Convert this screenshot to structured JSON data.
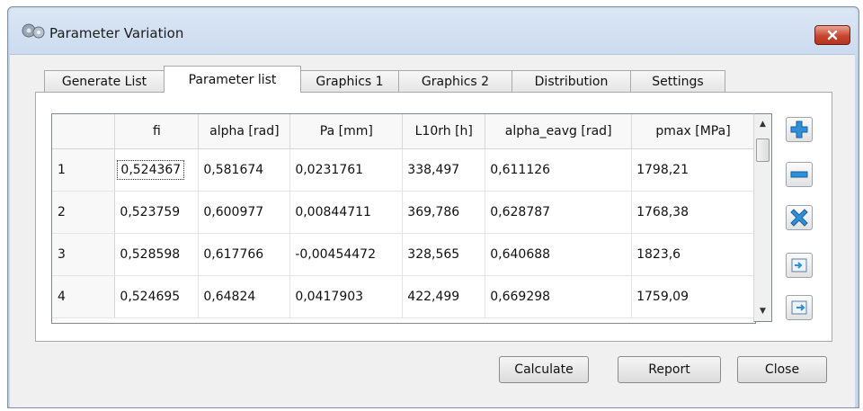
{
  "window": {
    "title": "Parameter Variation"
  },
  "tabs": [
    {
      "label": "Generate List"
    },
    {
      "label": "Parameter list"
    },
    {
      "label": "Graphics 1"
    },
    {
      "label": "Graphics 2"
    },
    {
      "label": "Distribution"
    },
    {
      "label": "Settings"
    }
  ],
  "active_tab": "Parameter list",
  "table": {
    "columns": [
      "fi",
      "alpha [rad]",
      "Pa [mm]",
      "L10rh [h]",
      "alpha_eavg [rad]",
      "pmax [MPa]"
    ],
    "rows": [
      {
        "id": "1",
        "cells": [
          "0,524367",
          "0,581674",
          "0,0231761",
          "338,497",
          "0,611126",
          "1798,21"
        ]
      },
      {
        "id": "2",
        "cells": [
          "0,523759",
          "0,600977",
          "0,00844711",
          "369,786",
          "0,628787",
          "1768,38"
        ]
      },
      {
        "id": "3",
        "cells": [
          "0,528598",
          "0,617766",
          "-0,00454472",
          "328,565",
          "0,640688",
          "1823,6"
        ]
      },
      {
        "id": "4",
        "cells": [
          "0,524695",
          "0,64824",
          "0,0417903",
          "422,499",
          "0,669298",
          "1759,09"
        ]
      }
    ]
  },
  "buttons": {
    "calculate": "Calculate",
    "report": "Report",
    "close": "Close"
  },
  "colors": {
    "accent_blue": "#2f8fd8",
    "close_red": "#c8452f"
  }
}
